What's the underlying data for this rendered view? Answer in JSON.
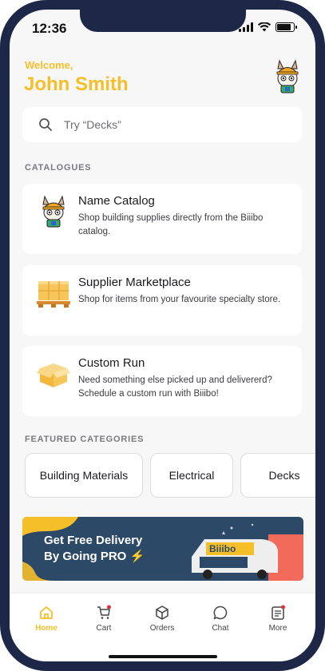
{
  "status_bar": {
    "time": "12:36"
  },
  "header": {
    "welcome": "Welcome,",
    "username": "John Smith"
  },
  "search": {
    "placeholder": "Try “Decks”"
  },
  "sections": {
    "catalogues": "CATALOGUES",
    "featured": "FEATURED CATEGORIES"
  },
  "catalogues": [
    {
      "title": "Name Catalog",
      "description": "Shop building supplies directly from the Biiibo catalog.",
      "icon": "mascot-icon"
    },
    {
      "title": "Supplier Marketplace",
      "description": "Shop for items from your favourite specialty store.",
      "icon": "pallet-icon"
    },
    {
      "title": "Custom Run",
      "description": "Need something else picked up and delivererd? Schedule a custom run with Biiibo!",
      "icon": "box-icon"
    }
  ],
  "featured_categories": [
    "Building Materials",
    "Electrical",
    "Decks"
  ],
  "banner": {
    "line1": "Get Free Delivery",
    "line2": "By Going PRO ⚡",
    "van_brand": "Biiibo"
  },
  "nav": {
    "items": [
      {
        "label": "Home",
        "icon": "home-icon"
      },
      {
        "label": "Cart",
        "icon": "cart-icon"
      },
      {
        "label": "Orders",
        "icon": "box-icon"
      },
      {
        "label": "Chat",
        "icon": "chat-icon"
      },
      {
        "label": "More",
        "icon": "more-icon"
      }
    ]
  },
  "colors": {
    "accent": "#f5bf2a",
    "navy": "#1d2747",
    "banner": "#2c4a67",
    "badge": "#e0303a"
  }
}
